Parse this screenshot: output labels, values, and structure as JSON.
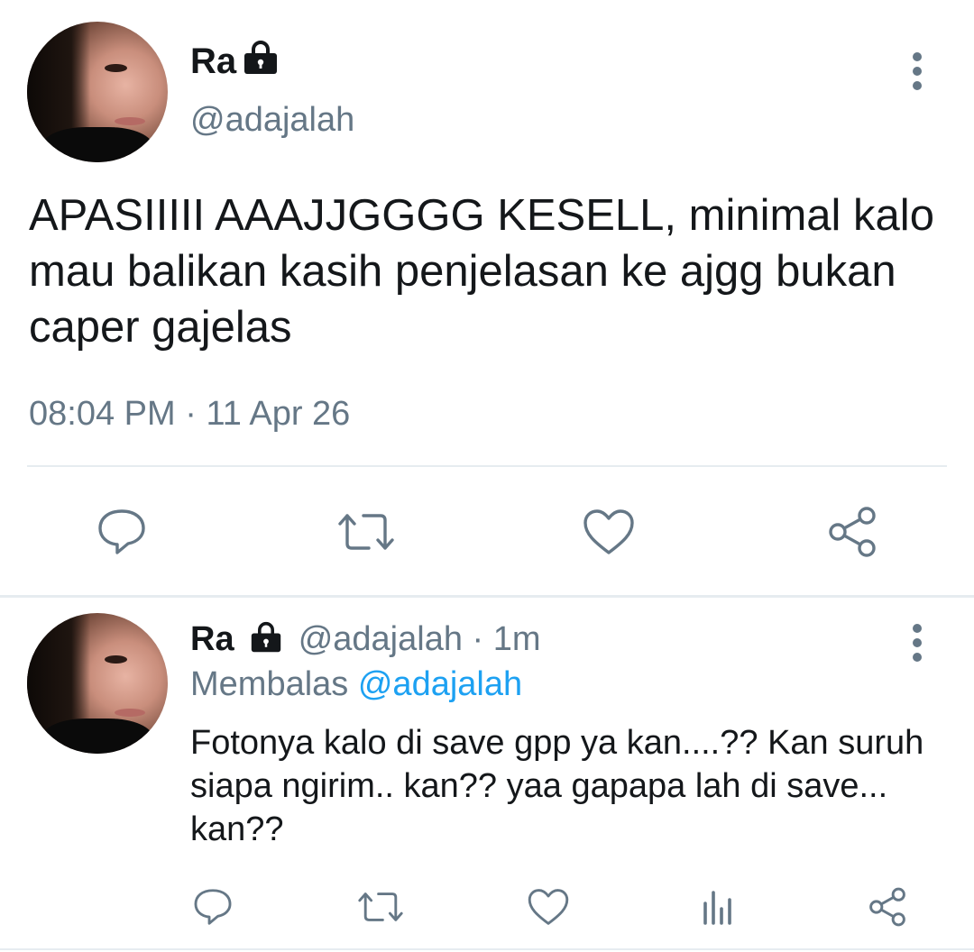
{
  "main_tweet": {
    "display_name": "Ra",
    "handle": "@adajalah",
    "text": "APASIIIII AAAJJGGGG KESELL, minimal kalo mau balikan kasih penjelasan ke ajgg bukan caper gajelas",
    "time": "08:04 PM",
    "separator": " · ",
    "date": "11 Apr 26",
    "actions": [
      "reply-icon",
      "retweet-icon",
      "like-icon",
      "share-icon"
    ]
  },
  "reply_tweet": {
    "display_name": "Ra",
    "handle": "@adajalah",
    "separator": " · ",
    "age": "1m",
    "replying_label": "Membalas",
    "replying_to": "@adajalah",
    "text": "Fotonya kalo di save gpp ya kan....?? Kan suruh siapa ngirim.. kan?? yaa gapapa lah di save... kan??",
    "actions": [
      "reply-icon",
      "retweet-icon",
      "like-icon",
      "analytics-icon",
      "share-icon"
    ]
  },
  "colors": {
    "text": "#14171a",
    "secondary": "#657786",
    "link": "#1da1f2",
    "divider": "#e6ecf0"
  }
}
